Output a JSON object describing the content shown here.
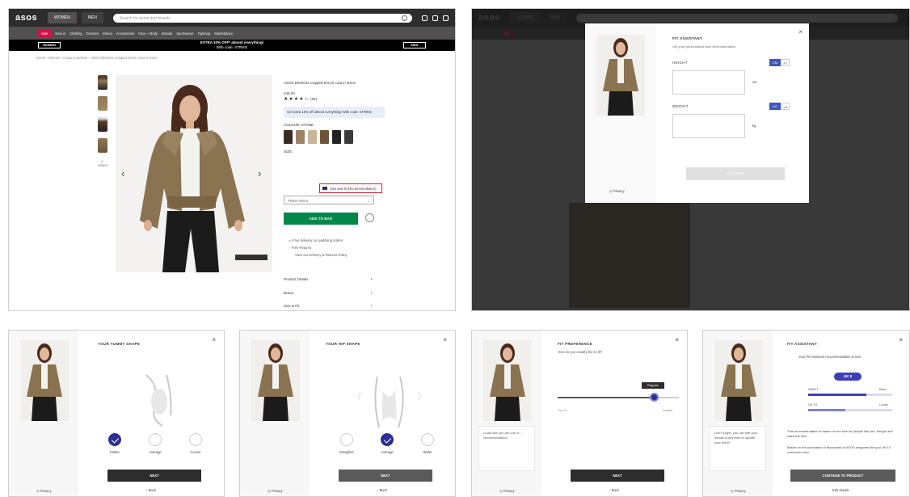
{
  "site": {
    "logo": "asos",
    "tabs": [
      "WOMEN",
      "MEN"
    ],
    "search_placeholder": "Search for items and brands",
    "nav_items": [
      "Sale",
      "New in",
      "Clothing",
      "Dresses",
      "Shoes",
      "Accessories",
      "Face + Body",
      "Brands",
      "Sportswear",
      "Topshop",
      "Marketplace"
    ],
    "promo_left": "WOMEN",
    "promo_text": "EXTRA 10% OFF* almost everything!",
    "promo_sub": "With code: STRIKE",
    "promo_right": "MEN",
    "breadcrumb": "Home  ›  Women  ›  Coats & Jackets  ›  ASOS DESIGN cropped trench coat in stone"
  },
  "product": {
    "name": "ASOS DESIGN cropped trench coat in stone",
    "price": "£45.00",
    "rating": "★★★★☆",
    "rating_count": "(64)",
    "info_box": "Get extra 10% off almost everything! With code: STRIKE",
    "colour_label": "COLOUR: STONE",
    "size_label": "SIZE:",
    "size_guide": "Size and fit (Recommendation)",
    "size_select": "Please select",
    "add_to_bag": "ADD TO BAG",
    "delivery_1": "Free delivery on qualifying orders.",
    "delivery_2": "Free Returns",
    "delivery_3": "View our Delivery & Returns Policy",
    "acc_1": "Product Details",
    "acc_2": "Brand",
    "acc_3": "Size & Fit",
    "video_label": "VIDEO",
    "view_label": "Buy the look"
  },
  "fit_modal": {
    "title": "FIT ASSISTANT",
    "subtitle": "Get your personalised size recommendation",
    "height_label": "HEIGHT",
    "height_unit_a": "CM",
    "height_unit_b": "FT",
    "height_suffix": "cm",
    "weight_label": "WEIGHT",
    "weight_unit_a": "KG",
    "weight_unit_b": "LB",
    "weight_suffix": "kg",
    "continue": "CONTINUE",
    "privacy": "Privacy"
  },
  "tummy": {
    "title": "YOUR TUMMY SHAPE",
    "options": [
      "Flatter",
      "Average",
      "Curvier"
    ],
    "next": "NEXT",
    "back": "Back",
    "privacy": "Privacy"
  },
  "hips": {
    "title": "YOUR HIP SHAPE",
    "options": [
      "Straighter",
      "Average",
      "Wider"
    ],
    "next": "NEXT",
    "back": "Back",
    "privacy": "Privacy"
  },
  "pref": {
    "title": "FIT PREFERENCE",
    "subtitle": "How do you usually like to fit?",
    "tooltip": "Regular",
    "left_lbl": "Tighter",
    "right_lbl": "Looser",
    "note": "Looks like you are one of ... recommendation",
    "next": "NEXT",
    "back": "Back",
    "privacy": "Privacy"
  },
  "result": {
    "title": "FIT ASSISTANT",
    "line": "Your Fit Assistant recommendation is size",
    "size": "UK 8",
    "bar1_label": "WAIST",
    "bar1_value": "Best",
    "bar2_label": "UK 10",
    "bar2_value": "Loose",
    "para1": "This recommendation is based on the size for people like you, bought and rated the item",
    "para2": "Based on the purchases of thousands of ASOS shoppers like you UK 10 customers who...",
    "note": "Don't forget, you can edit your details at any time to update your result",
    "cta": "CONTINUE TO PRODUCT",
    "edit": "Edit details",
    "privacy": "Privacy"
  },
  "colors": {
    "dark": "#2d2d2d",
    "sale": "#d01345",
    "green": "#018849",
    "accent": "#2b2e95",
    "highlight": "#d8202f"
  }
}
